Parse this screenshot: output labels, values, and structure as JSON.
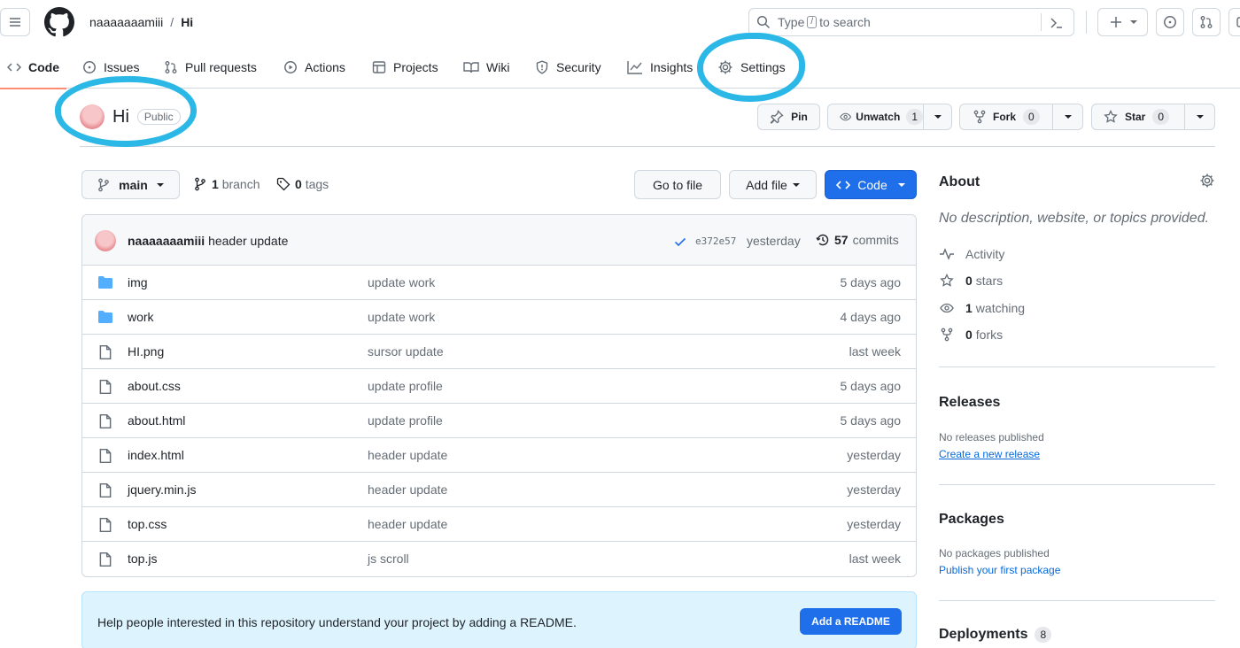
{
  "header": {
    "owner": "naaaaaaamiii",
    "separator": "/",
    "repo": "Hi",
    "search": {
      "prefix": "Type",
      "key": "/",
      "suffix": "to search"
    }
  },
  "nav": {
    "tabs": [
      {
        "label": "Code"
      },
      {
        "label": "Issues"
      },
      {
        "label": "Pull requests"
      },
      {
        "label": "Actions"
      },
      {
        "label": "Projects"
      },
      {
        "label": "Wiki"
      },
      {
        "label": "Security"
      },
      {
        "label": "Insights"
      },
      {
        "label": "Settings"
      }
    ]
  },
  "repo": {
    "name": "Hi",
    "visibility": "Public",
    "pin_label": "Pin",
    "watch_label": "Unwatch",
    "watch_count": "1",
    "fork_label": "Fork",
    "fork_count": "0",
    "star_label": "Star",
    "star_count": "0"
  },
  "branchbar": {
    "branch": "main",
    "branch_count": "1",
    "branch_label": "branch",
    "tag_count": "0",
    "tag_label": "tags",
    "goto_label": "Go to file",
    "addfile_label": "Add file",
    "code_label": "Code"
  },
  "commit": {
    "author": "naaaaaaamiii",
    "message": "header update",
    "hash": "e372e57",
    "time": "yesterday",
    "count": "57",
    "count_label": "commits"
  },
  "files": [
    {
      "type": "folder",
      "name": "img",
      "message": "update work",
      "age": "5 days ago"
    },
    {
      "type": "folder",
      "name": "work",
      "message": "update work",
      "age": "4 days ago"
    },
    {
      "type": "file",
      "name": "HI.png",
      "message": "sursor update",
      "age": "last week"
    },
    {
      "type": "file",
      "name": "about.css",
      "message": "update profile",
      "age": "5 days ago"
    },
    {
      "type": "file",
      "name": "about.html",
      "message": "update profile",
      "age": "5 days ago"
    },
    {
      "type": "file",
      "name": "index.html",
      "message": "header update",
      "age": "yesterday"
    },
    {
      "type": "file",
      "name": "jquery.min.js",
      "message": "header update",
      "age": "yesterday"
    },
    {
      "type": "file",
      "name": "top.css",
      "message": "header update",
      "age": "yesterday"
    },
    {
      "type": "file",
      "name": "top.js",
      "message": "js scroll",
      "age": "last week"
    }
  ],
  "readme": {
    "text": "Help people interested in this repository understand your project by adding a README.",
    "button": "Add a README"
  },
  "about": {
    "title": "About",
    "description": "No description, website, or topics provided.",
    "activity": "Activity",
    "stars_count": "0",
    "stars_label": "stars",
    "watching_count": "1",
    "watching_label": "watching",
    "forks_count": "0",
    "forks_label": "forks"
  },
  "releases": {
    "title": "Releases",
    "empty": "No releases published",
    "link": "Create a new release"
  },
  "packages": {
    "title": "Packages",
    "empty": "No packages published",
    "link": "Publish your first package"
  },
  "deployments": {
    "title": "Deployments",
    "count": "8"
  },
  "colors": {
    "accent": "#1f6feb",
    "annotation": "#2bb8e6",
    "folder": "#54aeff",
    "active_tab_underline": "#fd8c73"
  }
}
